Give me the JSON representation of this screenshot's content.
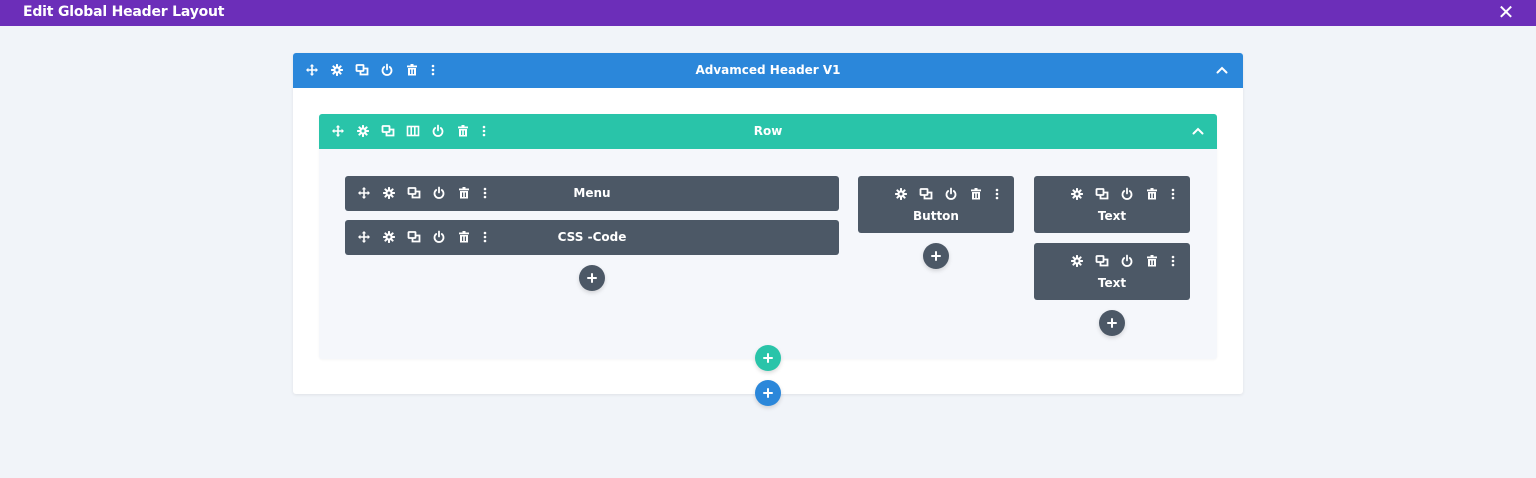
{
  "topbar": {
    "title": "Edit Global Header Layout",
    "close_glyph": "✕",
    "background": "#6c2eb9"
  },
  "section": {
    "title": "Advamced Header V1",
    "color": "#2b87da"
  },
  "row": {
    "title": "Row",
    "color": "#29c4a9"
  },
  "modules": {
    "menu": {
      "label": "Menu"
    },
    "css_code": {
      "label": "CSS -Code"
    },
    "button": {
      "label": "Button"
    },
    "text_1": {
      "label": "Text"
    },
    "text_2": {
      "label": "Text"
    }
  },
  "icons": [
    "move-icon",
    "settings-icon",
    "duplicate-icon",
    "columns-icon",
    "power-icon",
    "trash-icon",
    "more-icon",
    "chevron-up-icon",
    "plus-icon",
    "close-icon"
  ],
  "colors": {
    "module": "#4c5866",
    "background": "#f1f4f9"
  }
}
